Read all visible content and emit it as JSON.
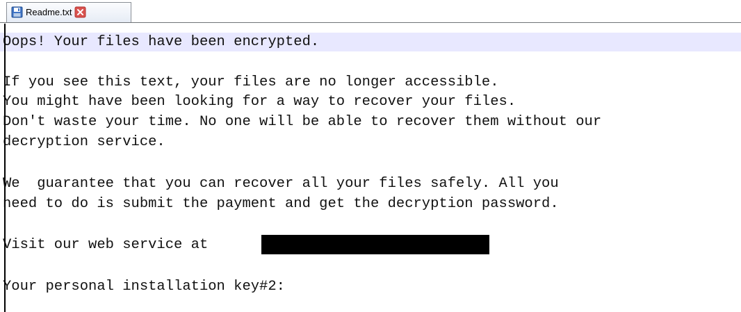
{
  "tab": {
    "filename": "Readme.txt",
    "icon": "save-disk-icon",
    "close_icon": "close-icon",
    "accent": "#d9534f"
  },
  "editor": {
    "lines": [
      "Oops! Your files have been encrypted.",
      "",
      "If you see this text, your files are no longer accessible.",
      "You might have been looking for a way to recover your files.",
      "Don't waste your time. No one will be able to recover them without our",
      "decryption service.",
      "",
      "We  guarantee that you can recover all your files safely. All you",
      "need to do is submit the payment and get the decryption password.",
      "",
      "Visit our web service at",
      "",
      "Your personal installation key#2:"
    ],
    "current_line_color": "#e8e8ff"
  }
}
